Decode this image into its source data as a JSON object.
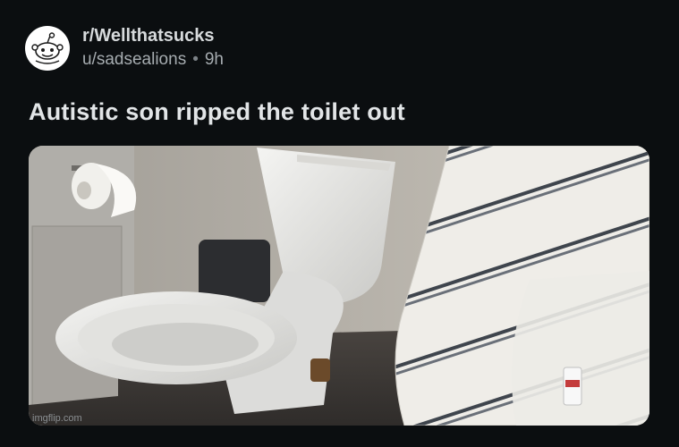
{
  "post": {
    "subreddit": "r/Wellthatsucks",
    "username": "u/sadsealions",
    "separator": "•",
    "age": "9h",
    "title": "Autistic son ripped the toilet out"
  },
  "media": {
    "icon": "photo-image",
    "alt_description": "toilet-photo"
  },
  "watermark": "imgflip.com",
  "colors": {
    "background": "#0b0e10",
    "title": "#e2e5e7",
    "meta": "#a6acb0"
  }
}
